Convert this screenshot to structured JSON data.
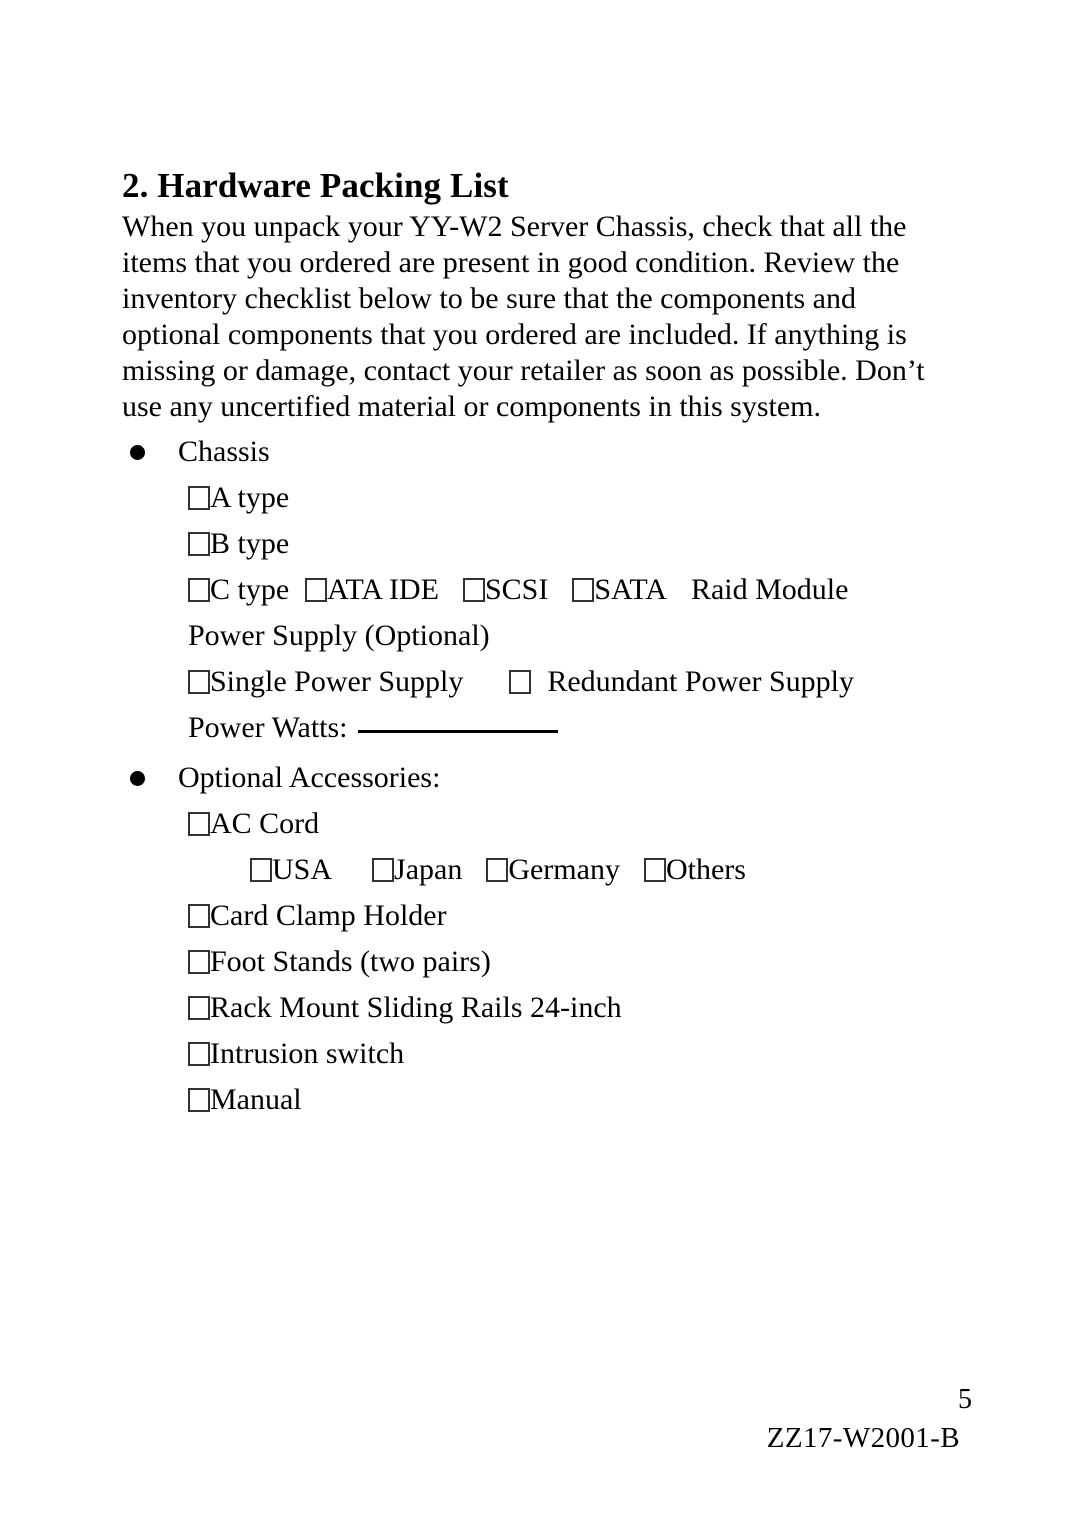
{
  "document": {
    "title": "2. Hardware Packing List",
    "intro": "When you unpack your YY-W2 Server Chassis, check that all the items that you ordered are present in good condition. Review the inventory checklist below to be sure that the components and optional components that you ordered are included. If anything is missing or damage, contact your retailer as soon as possible. Don’t use any uncertified material or components in this system."
  },
  "sections": {
    "chassis": {
      "heading": "Chassis",
      "a_type": "A type",
      "b_type": "B type",
      "c_type": "C type",
      "ata_ide": "ATA IDE",
      "scsi": "SCSI",
      "sata": "SATA",
      "raid_module": "Raid Module",
      "power_supply_heading": "Power Supply (Optional)",
      "single_power_supply": "Single Power Supply",
      "redundant_power_supply": "Redundant Power Supply",
      "power_watts_label": "Power Watts:",
      "power_watts_value": ""
    },
    "accessories": {
      "heading": "Optional Accessories:",
      "ac_cord": "AC Cord",
      "usa": "USA",
      "japan": "Japan",
      "germany": "Germany",
      "others": "Others",
      "card_clamp_holder": "Card Clamp Holder",
      "foot_stands": "Foot Stands (two pairs)",
      "rack_mount_rails": "Rack Mount Sliding Rails 24-inch",
      "intrusion_switch": "Intrusion switch",
      "manual": "Manual"
    }
  },
  "footer": {
    "page_number": "5",
    "doc_code": "ZZ17-W2001-B"
  }
}
